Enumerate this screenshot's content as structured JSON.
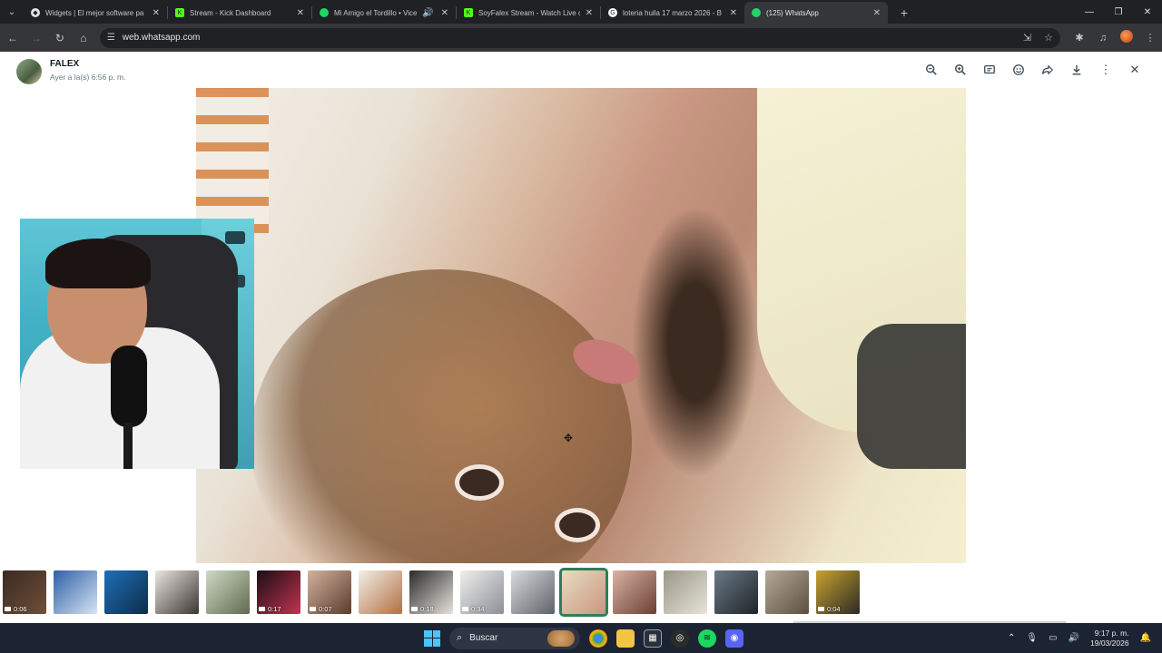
{
  "browser": {
    "tabs": [
      {
        "title": "Widgets | El mejor software pa",
        "icon": "widgets-icon",
        "color": "#e3e3e3"
      },
      {
        "title": "Stream - Kick Dashboard",
        "icon": "kick-icon",
        "color": "#53fc18"
      },
      {
        "title": "Mi Amigo el Tordillo • Vice",
        "icon": "spotify-icon",
        "color": "#1ed760"
      },
      {
        "title": "SoyFalex Stream - Watch Live o",
        "icon": "kick-icon",
        "color": "#53fc18"
      },
      {
        "title": "loteria huila 17 marzo 2026 - B",
        "icon": "google-icon",
        "color": "#ffffff"
      },
      {
        "title": "(125) WhatsApp",
        "icon": "whatsapp-icon",
        "color": "#25d366"
      }
    ],
    "url": "web.whatsapp.com"
  },
  "viewer": {
    "sender_name": "FALEX",
    "sender_time": "Ayer a la(s) 6:56 p. m."
  },
  "thumbnails": [
    {
      "duration": "0:06",
      "colors": [
        "#3b2a22",
        "#6e4f3a"
      ]
    },
    {
      "duration": "",
      "colors": [
        "#2f5fa7",
        "#d6e4f3"
      ]
    },
    {
      "duration": "",
      "colors": [
        "#1f6fb8",
        "#0e2c4a"
      ]
    },
    {
      "duration": "",
      "colors": [
        "#e9e6df",
        "#3b3531"
      ]
    },
    {
      "duration": "",
      "colors": [
        "#cfd9c8",
        "#5f6b4c"
      ]
    },
    {
      "duration": "0:17",
      "colors": [
        "#1a0d16",
        "#c2334e"
      ]
    },
    {
      "duration": "0:07",
      "colors": [
        "#d3b39e",
        "#5a3b2c"
      ]
    },
    {
      "duration": "",
      "colors": [
        "#f2efe8",
        "#b16f42"
      ]
    },
    {
      "duration": "0:18",
      "colors": [
        "#2b2b2b",
        "#e6e2de"
      ]
    },
    {
      "duration": "0:34",
      "colors": [
        "#f1efec",
        "#8b8f96"
      ]
    },
    {
      "duration": "",
      "colors": [
        "#d9dbde",
        "#5d6268"
      ]
    },
    {
      "duration": "",
      "colors": [
        "#e8ddc0",
        "#c99680"
      ]
    },
    {
      "duration": "",
      "colors": [
        "#d9b3a3",
        "#6a3f33"
      ]
    },
    {
      "duration": "",
      "colors": [
        "#9a9789",
        "#e6e3d8"
      ]
    },
    {
      "duration": "",
      "colors": [
        "#6b7a86",
        "#1f2429"
      ]
    },
    {
      "duration": "",
      "colors": [
        "#b5a99a",
        "#5d4f40"
      ]
    },
    {
      "duration": "0:04",
      "colors": [
        "#c9a22f",
        "#2b2a25"
      ]
    }
  ],
  "taskbar": {
    "search_placeholder": "Buscar",
    "time": "9:17 p. m.",
    "date": "19/03/2026"
  }
}
